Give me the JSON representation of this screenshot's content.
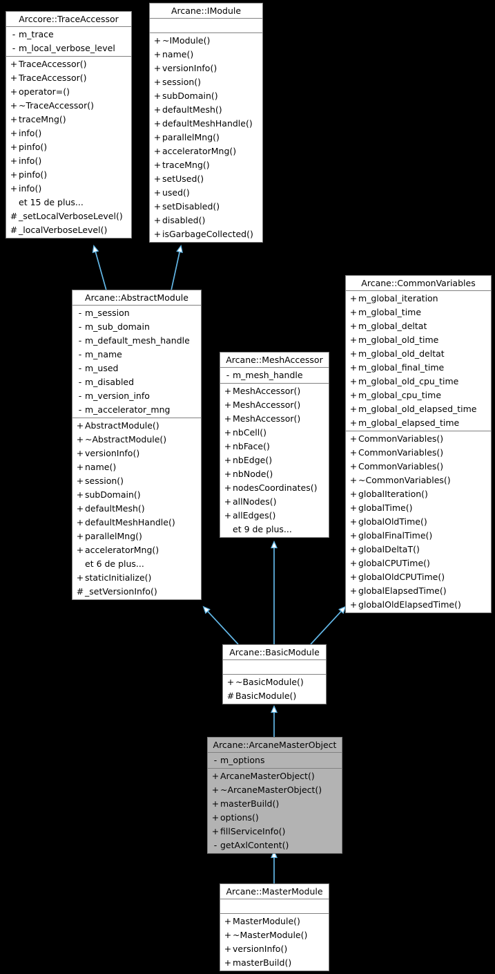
{
  "diagram": {
    "kind": "uml-class-inheritance-diagram",
    "background": "#000000",
    "box_fill": "#ffffff",
    "box_border": "#808080",
    "highlight_fill": "#b3b3b3",
    "arrow_color": "#63b8e8",
    "more_label_15": "et 15 de plus...",
    "more_label_6": "et 6 de plus...",
    "more_label_9": "et 9 de plus..."
  },
  "classes": {
    "trace_accessor": {
      "title": "Arccore::TraceAccessor",
      "attributes": [
        {
          "vis": "-",
          "name": "m_trace"
        },
        {
          "vis": "-",
          "name": "m_local_verbose_level"
        }
      ],
      "operations": [
        {
          "vis": "+",
          "name": "TraceAccessor()"
        },
        {
          "vis": "+",
          "name": "TraceAccessor()"
        },
        {
          "vis": "+",
          "name": "operator=()"
        },
        {
          "vis": "+",
          "name": "~TraceAccessor()"
        },
        {
          "vis": "+",
          "name": "traceMng()"
        },
        {
          "vis": "+",
          "name": "info()"
        },
        {
          "vis": "+",
          "name": "pinfo()"
        },
        {
          "vis": "+",
          "name": "info()"
        },
        {
          "vis": "+",
          "name": "pinfo()"
        },
        {
          "vis": "+",
          "name": "info()"
        },
        {
          "vis": "",
          "name": "et 15 de plus..."
        },
        {
          "vis": "#",
          "name": "_setLocalVerboseLevel()"
        },
        {
          "vis": "#",
          "name": "_localVerboseLevel()"
        }
      ]
    },
    "imodule": {
      "title": "Arcane::IModule",
      "attributes": [],
      "operations": [
        {
          "vis": "+",
          "name": "~IModule()"
        },
        {
          "vis": "+",
          "name": "name()"
        },
        {
          "vis": "+",
          "name": "versionInfo()"
        },
        {
          "vis": "+",
          "name": "session()"
        },
        {
          "vis": "+",
          "name": "subDomain()"
        },
        {
          "vis": "+",
          "name": "defaultMesh()"
        },
        {
          "vis": "+",
          "name": "defaultMeshHandle()"
        },
        {
          "vis": "+",
          "name": "parallelMng()"
        },
        {
          "vis": "+",
          "name": "acceleratorMng()"
        },
        {
          "vis": "+",
          "name": "traceMng()"
        },
        {
          "vis": "+",
          "name": "setUsed()"
        },
        {
          "vis": "+",
          "name": "used()"
        },
        {
          "vis": "+",
          "name": "setDisabled()"
        },
        {
          "vis": "+",
          "name": "disabled()"
        },
        {
          "vis": "+",
          "name": "isGarbageCollected()"
        }
      ]
    },
    "abstract_module": {
      "title": "Arcane::AbstractModule",
      "attributes": [
        {
          "vis": "-",
          "name": "m_session"
        },
        {
          "vis": "-",
          "name": "m_sub_domain"
        },
        {
          "vis": "-",
          "name": "m_default_mesh_handle"
        },
        {
          "vis": "-",
          "name": "m_name"
        },
        {
          "vis": "-",
          "name": "m_used"
        },
        {
          "vis": "-",
          "name": "m_disabled"
        },
        {
          "vis": "-",
          "name": "m_version_info"
        },
        {
          "vis": "-",
          "name": "m_accelerator_mng"
        }
      ],
      "operations": [
        {
          "vis": "+",
          "name": "AbstractModule()"
        },
        {
          "vis": "+",
          "name": "~AbstractModule()"
        },
        {
          "vis": "+",
          "name": "versionInfo()"
        },
        {
          "vis": "+",
          "name": "name()"
        },
        {
          "vis": "+",
          "name": "session()"
        },
        {
          "vis": "+",
          "name": "subDomain()"
        },
        {
          "vis": "+",
          "name": "defaultMesh()"
        },
        {
          "vis": "+",
          "name": "defaultMeshHandle()"
        },
        {
          "vis": "+",
          "name": "parallelMng()"
        },
        {
          "vis": "+",
          "name": "acceleratorMng()"
        },
        {
          "vis": "",
          "name": "et 6 de plus..."
        },
        {
          "vis": "+",
          "name": "staticInitialize()"
        },
        {
          "vis": "#",
          "name": "_setVersionInfo()"
        }
      ]
    },
    "mesh_accessor": {
      "title": "Arcane::MeshAccessor",
      "attributes": [
        {
          "vis": "-",
          "name": "m_mesh_handle"
        }
      ],
      "operations": [
        {
          "vis": "+",
          "name": "MeshAccessor()"
        },
        {
          "vis": "+",
          "name": "MeshAccessor()"
        },
        {
          "vis": "+",
          "name": "MeshAccessor()"
        },
        {
          "vis": "+",
          "name": "nbCell()"
        },
        {
          "vis": "+",
          "name": "nbFace()"
        },
        {
          "vis": "+",
          "name": "nbEdge()"
        },
        {
          "vis": "+",
          "name": "nbNode()"
        },
        {
          "vis": "+",
          "name": "nodesCoordinates()"
        },
        {
          "vis": "+",
          "name": "allNodes()"
        },
        {
          "vis": "+",
          "name": "allEdges()"
        },
        {
          "vis": "",
          "name": "et 9 de plus..."
        }
      ]
    },
    "common_variables": {
      "title": "Arcane::CommonVariables",
      "attributes": [
        {
          "vis": "+",
          "name": "m_global_iteration"
        },
        {
          "vis": "+",
          "name": "m_global_time"
        },
        {
          "vis": "+",
          "name": "m_global_deltat"
        },
        {
          "vis": "+",
          "name": "m_global_old_time"
        },
        {
          "vis": "+",
          "name": "m_global_old_deltat"
        },
        {
          "vis": "+",
          "name": "m_global_final_time"
        },
        {
          "vis": "+",
          "name": "m_global_old_cpu_time"
        },
        {
          "vis": "+",
          "name": "m_global_cpu_time"
        },
        {
          "vis": "+",
          "name": "m_global_old_elapsed_time"
        },
        {
          "vis": "+",
          "name": "m_global_elapsed_time"
        }
      ],
      "operations": [
        {
          "vis": "+",
          "name": "CommonVariables()"
        },
        {
          "vis": "+",
          "name": "CommonVariables()"
        },
        {
          "vis": "+",
          "name": "CommonVariables()"
        },
        {
          "vis": "+",
          "name": "~CommonVariables()"
        },
        {
          "vis": "+",
          "name": "globalIteration()"
        },
        {
          "vis": "+",
          "name": "globalTime()"
        },
        {
          "vis": "+",
          "name": "globalOldTime()"
        },
        {
          "vis": "+",
          "name": "globalFinalTime()"
        },
        {
          "vis": "+",
          "name": "globalDeltaT()"
        },
        {
          "vis": "+",
          "name": "globalCPUTime()"
        },
        {
          "vis": "+",
          "name": "globalOldCPUTime()"
        },
        {
          "vis": "+",
          "name": "globalElapsedTime()"
        },
        {
          "vis": "+",
          "name": "globalOldElapsedTime()"
        }
      ]
    },
    "basic_module": {
      "title": "Arcane::BasicModule",
      "attributes": [],
      "operations": [
        {
          "vis": "+",
          "name": "~BasicModule()"
        },
        {
          "vis": "#",
          "name": "BasicModule()"
        }
      ]
    },
    "arcane_master_object": {
      "title": "Arcane::ArcaneMasterObject",
      "highlighted": true,
      "attributes": [
        {
          "vis": "-",
          "name": "m_options"
        }
      ],
      "operations": [
        {
          "vis": "+",
          "name": "ArcaneMasterObject()"
        },
        {
          "vis": "+",
          "name": "~ArcaneMasterObject()"
        },
        {
          "vis": "+",
          "name": "masterBuild()"
        },
        {
          "vis": "+",
          "name": "options()"
        },
        {
          "vis": "+",
          "name": "fillServiceInfo()"
        },
        {
          "vis": "-",
          "name": "getAxlContent()"
        }
      ]
    },
    "master_module": {
      "title": "Arcane::MasterModule",
      "attributes": [],
      "operations": [
        {
          "vis": "+",
          "name": "MasterModule()"
        },
        {
          "vis": "+",
          "name": "~MasterModule()"
        },
        {
          "vis": "+",
          "name": "versionInfo()"
        },
        {
          "vis": "+",
          "name": "masterBuild()"
        }
      ]
    }
  },
  "inheritance_edges": [
    {
      "from": "abstract_module",
      "to": "trace_accessor"
    },
    {
      "from": "abstract_module",
      "to": "imodule"
    },
    {
      "from": "basic_module",
      "to": "abstract_module"
    },
    {
      "from": "basic_module",
      "to": "mesh_accessor"
    },
    {
      "from": "basic_module",
      "to": "common_variables"
    },
    {
      "from": "arcane_master_object",
      "to": "basic_module"
    },
    {
      "from": "master_module",
      "to": "arcane_master_object"
    }
  ]
}
